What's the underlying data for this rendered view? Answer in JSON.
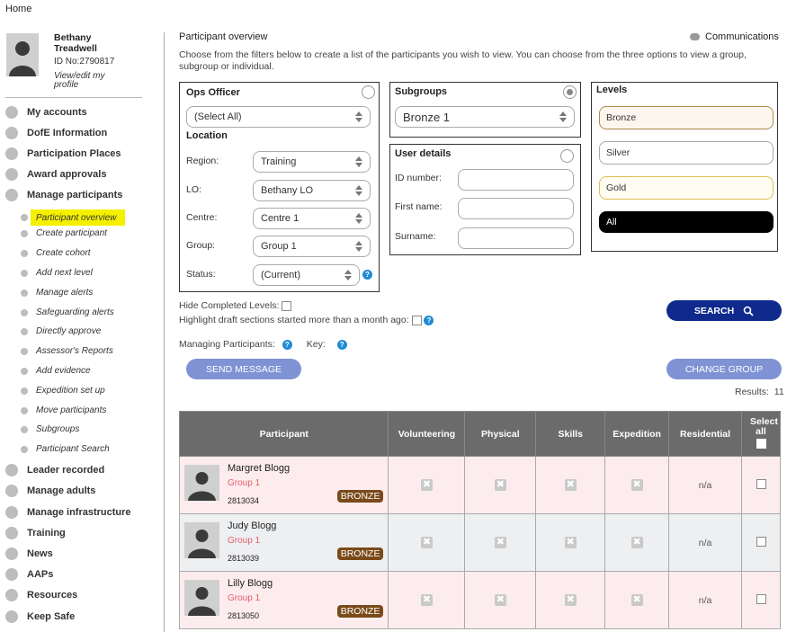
{
  "breadcrumb": "Home",
  "profile": {
    "name": "Bethany Treadwell",
    "id": "ID No:2790817",
    "edit": "View/edit my profile"
  },
  "nav": [
    {
      "label": "My accounts",
      "icon": "account-icon"
    },
    {
      "label": "DofE Information",
      "icon": "info-icon"
    },
    {
      "label": "Participation Places",
      "icon": "places-icon"
    },
    {
      "label": "Award approvals",
      "icon": "check-icon"
    },
    {
      "label": "Manage participants",
      "icon": "participants-icon"
    }
  ],
  "subnav": [
    "Participant overview",
    "Create participant",
    "Create cohort",
    "Add next level",
    "Manage alerts",
    "Safeguarding alerts",
    "Directly approve",
    "Assessor's Reports",
    "Add evidence",
    "Expedition set up",
    "Move participants",
    "Subgroups",
    "Participant Search"
  ],
  "nav2": [
    {
      "label": "Leader recorded",
      "icon": "leader-icon"
    },
    {
      "label": "Manage adults",
      "icon": "adults-icon"
    },
    {
      "label": "Manage infrastructure",
      "icon": "infrastructure-icon"
    },
    {
      "label": "Training",
      "icon": "training-icon"
    },
    {
      "label": "News",
      "icon": "news-icon"
    },
    {
      "label": "AAPs",
      "icon": "aaps-icon"
    },
    {
      "label": "Resources",
      "icon": "resources-icon"
    },
    {
      "label": "Keep Safe",
      "icon": "keepsafe-icon"
    }
  ],
  "main": {
    "title": "Participant overview",
    "communications": "Communications",
    "description": "Choose from the filters below to create a list of the participants you wish to view. You can choose from the three options to view a group, subgroup or individual."
  },
  "ops": {
    "heading": "Ops Officer",
    "officer": "(Select All)",
    "location_heading": "Location",
    "fields": [
      {
        "label": "Region:",
        "value": "Training"
      },
      {
        "label": "LO:",
        "value": "Bethany LO"
      },
      {
        "label": "Centre:",
        "value": "Centre 1"
      },
      {
        "label": "Group:",
        "value": "Group 1"
      },
      {
        "label": "Status:",
        "value": "(Current)"
      }
    ]
  },
  "subgroups": {
    "heading": "Subgroups",
    "value": "Bronze 1"
  },
  "user": {
    "heading": "User details",
    "fields": [
      "ID number:",
      "First name:",
      "Surname:"
    ]
  },
  "levels": {
    "heading": "Levels",
    "items": [
      "Bronze",
      "Silver",
      "Gold",
      "All"
    ]
  },
  "options": {
    "hide_completed": "Hide Completed Levels:",
    "highlight": "Highlight draft sections started more than a month ago:",
    "managing": "Managing Participants:",
    "key": "Key:"
  },
  "buttons": {
    "search": "SEARCH",
    "send": "SEND MESSAGE",
    "change": "CHANGE GROUP"
  },
  "results": {
    "label": "Results:",
    "count": "11"
  },
  "table": {
    "headers": [
      "Participant",
      "Volunteering",
      "Physical",
      "Skills",
      "Expedition",
      "Residential",
      "Select all"
    ],
    "rows": [
      {
        "name": "Margret Blogg",
        "group": "Group 1",
        "id": "2813034",
        "badge": "BRONZE",
        "residential": "n/a"
      },
      {
        "name": "Judy Blogg",
        "group": "Group 1",
        "id": "2813039",
        "badge": "BRONZE",
        "residential": "n/a"
      },
      {
        "name": "Lilly Blogg",
        "group": "Group 1",
        "id": "2813050",
        "badge": "BRONZE",
        "residential": "n/a"
      }
    ]
  },
  "colors": {
    "navy": "#0f2a8c",
    "button_blue": "#7f93d4",
    "badge_brown": "#7a4a1a",
    "highlight": "#f5f000"
  }
}
